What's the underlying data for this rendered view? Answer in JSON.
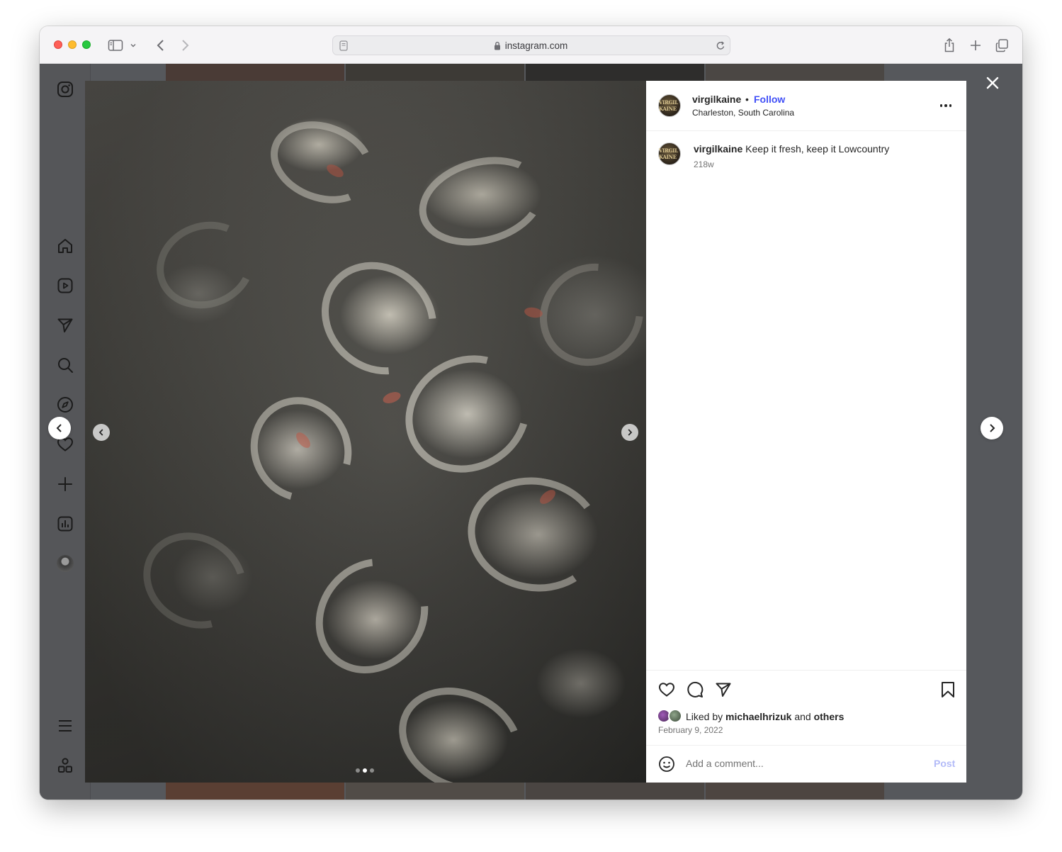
{
  "browser": {
    "url": "instagram.com"
  },
  "nav": {
    "items": [
      {
        "icon": "instagram-logo-icon"
      },
      {
        "icon": "home-icon"
      },
      {
        "icon": "reels-icon"
      },
      {
        "icon": "direct-icon"
      },
      {
        "icon": "search-icon"
      },
      {
        "icon": "explore-icon"
      },
      {
        "icon": "heart-icon"
      },
      {
        "icon": "plus-icon"
      },
      {
        "icon": "insights-icon"
      },
      {
        "icon": "profile-avatar"
      },
      {
        "icon": "menu-icon"
      },
      {
        "icon": "apps-icon"
      }
    ]
  },
  "post": {
    "username": "virgilkaine",
    "separator": "•",
    "follow_label": "Follow",
    "location": "Charleston, South Carolina",
    "avatar_text": "VIRGIL KAINE",
    "caption_user": "virgilkaine",
    "caption_text": "Keep it fresh, keep it Lowcountry",
    "caption_age": "218w",
    "liked_prefix": "Liked by",
    "liked_user": "michaelhrizuk",
    "liked_mid": "and",
    "liked_suffix": "others",
    "date": "February 9, 2022",
    "comment_placeholder": "Add a comment...",
    "post_label": "Post",
    "slide_count": 3,
    "active_slide": 2
  },
  "colors": {
    "follow": "#4150f7",
    "post_disabled": "#b3bbf8",
    "overlay": "#56585c"
  }
}
